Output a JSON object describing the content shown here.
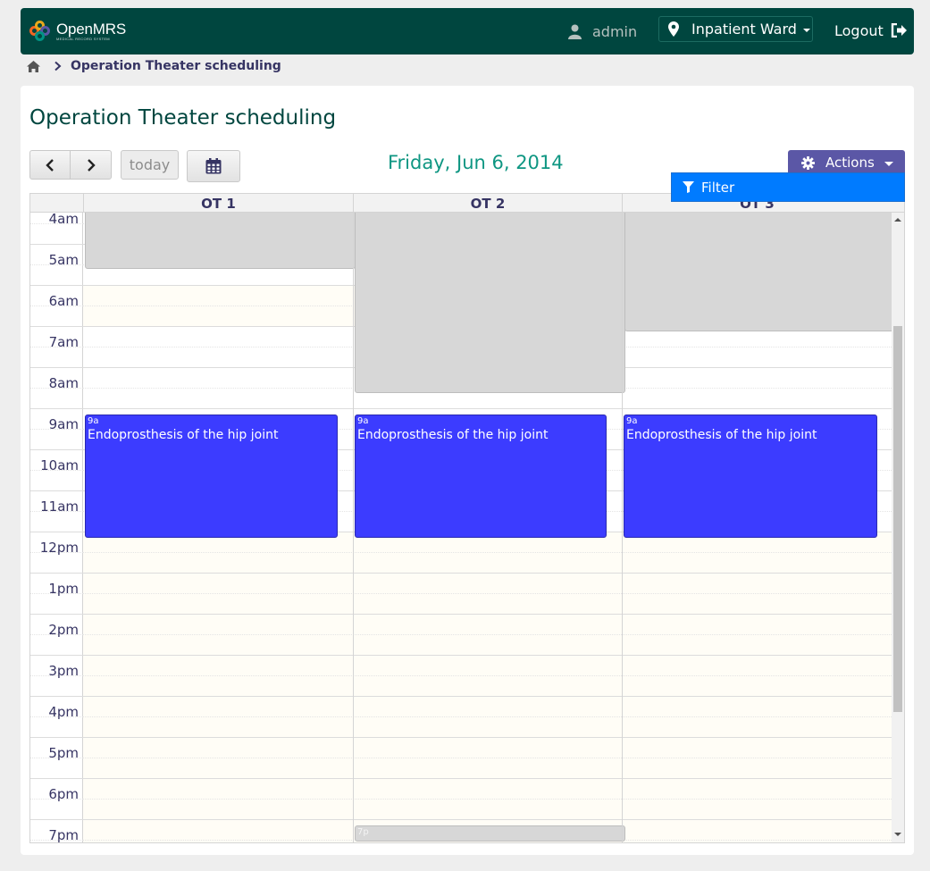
{
  "header": {
    "logo_name": "OpenMRS",
    "logo_subtitle": "MEDICAL RECORD SYSTEM",
    "username": "admin",
    "location": "Inpatient Ward",
    "logout_label": "Logout"
  },
  "breadcrumb": {
    "current": "Operation Theater scheduling"
  },
  "page": {
    "title": "Operation Theater scheduling"
  },
  "toolbar": {
    "today_label": "today",
    "date": "Friday, Jun 6, 2014",
    "actions_label": "Actions"
  },
  "dropdown": {
    "filter_label": "Filter"
  },
  "calendar": {
    "columns": [
      "OT 1",
      "OT 2",
      "OT 3"
    ],
    "hours": [
      "4am",
      "5am",
      "6am",
      "7am",
      "8am",
      "9am",
      "10am",
      "11am",
      "12pm",
      "1pm",
      "2pm",
      "3pm",
      "4pm",
      "5pm",
      "6pm",
      "7pm"
    ],
    "blocked_label_7p": "7p",
    "events": [
      {
        "time": "9a",
        "title": "Endoprosthesis of the hip joint"
      },
      {
        "time": "9a",
        "title": "Endoprosthesis of the hip joint"
      },
      {
        "time": "9a",
        "title": "Endoprosthesis of the hip joint"
      }
    ]
  },
  "colors": {
    "header_bg": "#00463f",
    "accent_purple": "#5b57a6",
    "event_blue": "#3c3cff",
    "date_teal": "#0e9682",
    "filter_blue": "#007bff"
  }
}
